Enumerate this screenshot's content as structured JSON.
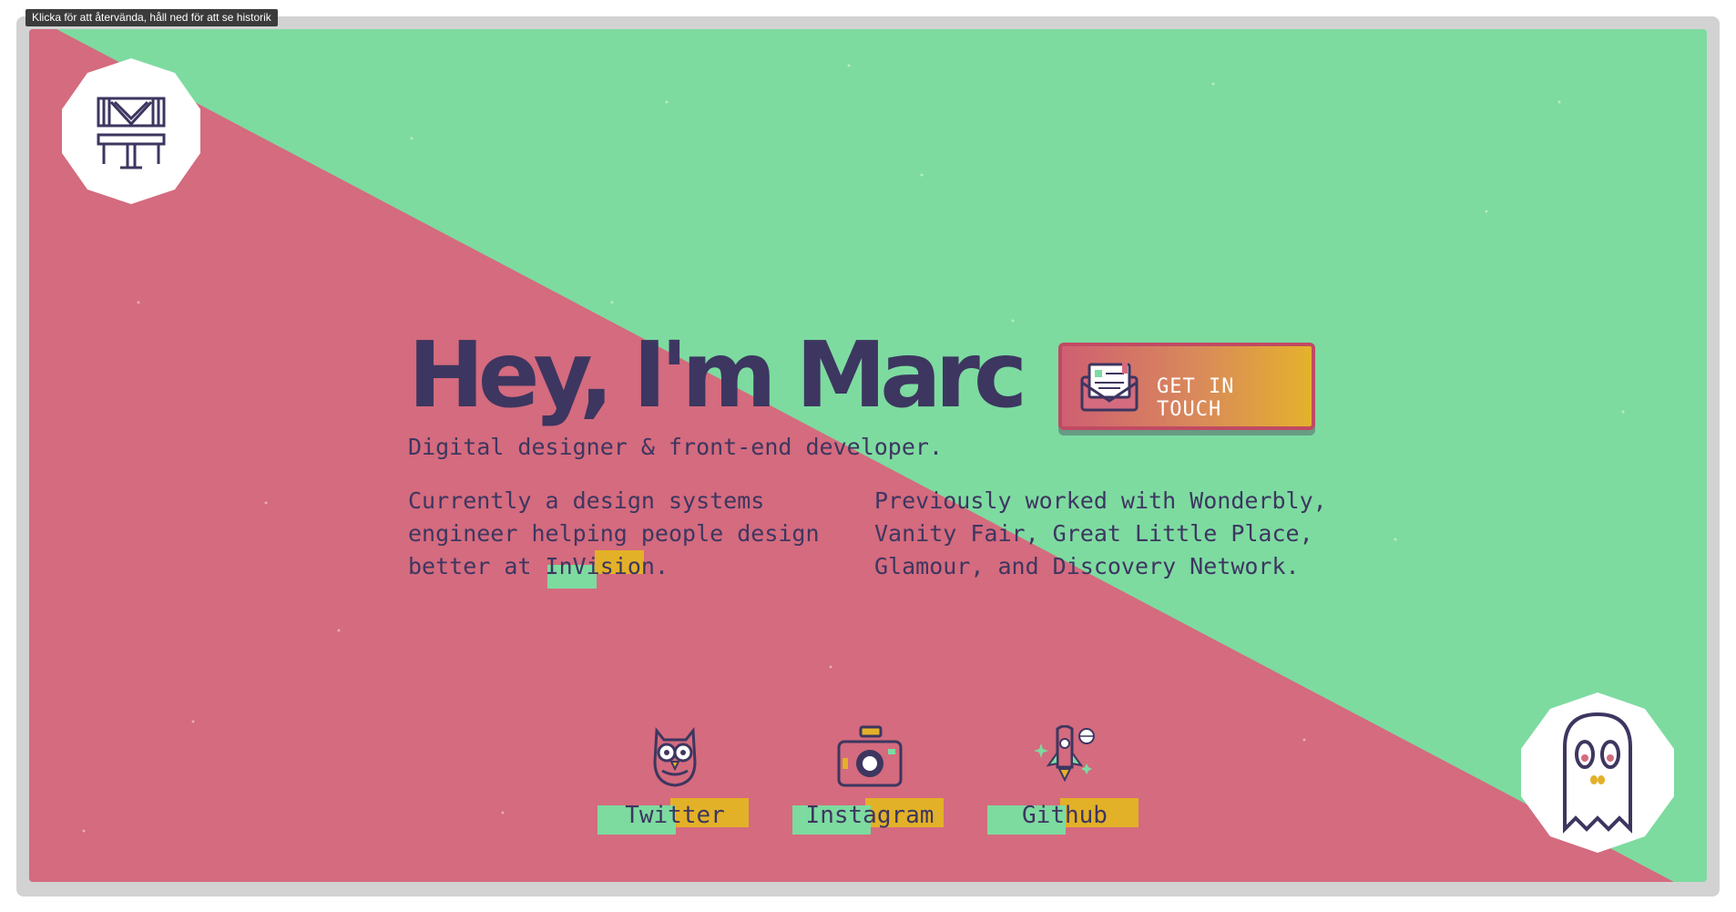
{
  "tooltip": "Klicka för att återvända, håll ned för att se historik",
  "hero": {
    "headline": "Hey, I'm Marc",
    "tagline": "Digital designer & front-end developer.",
    "current_prefix": "Currently a design systems engineer helping people design better at ",
    "current_company": "InVision",
    "current_suffix": ".",
    "previous": "Previously worked with Wonderbly, Vanity Fair, Great Little Place, Glamour, and Discovery Network."
  },
  "cta": {
    "label": "GET IN TOUCH"
  },
  "social": [
    {
      "label": "Twitter"
    },
    {
      "label": "Instagram"
    },
    {
      "label": "Github"
    }
  ],
  "colors": {
    "green": "#7ddba0",
    "pink": "#d46b7e",
    "navy": "#3d3660",
    "yellow": "#e3b128",
    "frame": "#d2d2d2"
  },
  "icons": [
    "logo-icon",
    "envelope-icon",
    "owl-icon",
    "camera-icon",
    "rocket-icon",
    "ghost-icon"
  ]
}
